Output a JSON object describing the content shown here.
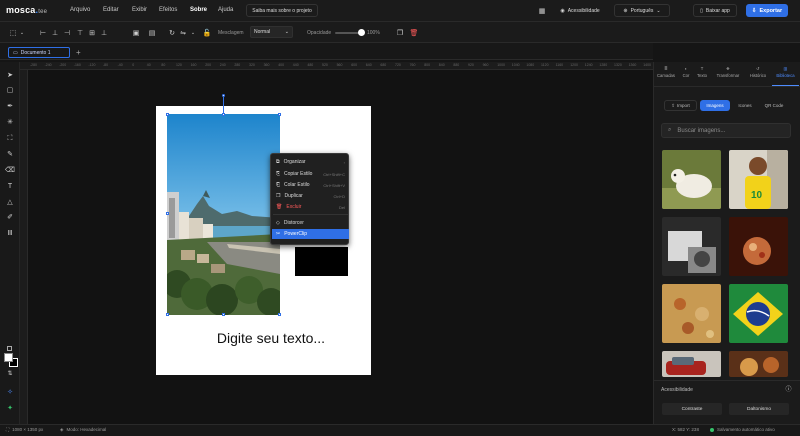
{
  "header": {
    "logo_main": "mosca",
    "logo_dot": ".",
    "logo_suffix": "tee",
    "menu": [
      "Arquivo",
      "Editar",
      "Exibir",
      "Efeitos",
      "Sobre",
      "Ajuda"
    ],
    "active_menu": "Sobre",
    "project_button": "Saiba mais sobre o projeto",
    "accessibility": "Acessibilidade",
    "language": "Português",
    "download_app": "Baixar app",
    "export": "Exportar"
  },
  "toolbar": {
    "blend_label": "Mesclagem",
    "blend_value": "Normal",
    "opacity_label": "Opacidade",
    "opacity_value": "100%"
  },
  "document_tab": {
    "label": "Documento 1",
    "add": "+"
  },
  "ruler": {
    "h_ticks": [
      "-280",
      "-240",
      "-200",
      "-160",
      "-120",
      "-80",
      "-40",
      "0",
      "40",
      "80",
      "120",
      "160",
      "200",
      "240",
      "280",
      "320",
      "360",
      "400",
      "440",
      "480",
      "520",
      "560",
      "600",
      "640",
      "680",
      "720",
      "760",
      "800",
      "840",
      "880",
      "920",
      "960",
      "1000",
      "1040",
      "1080",
      "1120",
      "1160",
      "1200",
      "1240",
      "1280",
      "1320",
      "1360",
      "1400"
    ]
  },
  "canvas": {
    "text": "Digite seu texto..."
  },
  "context_menu": {
    "items": [
      {
        "label": "Organizar",
        "shortcut": "›",
        "icon": "⧉",
        "style": "normal"
      },
      {
        "label": "Copiar Estilo",
        "shortcut": "Ctrl+Shift+C",
        "icon": "⎘",
        "style": "normal"
      },
      {
        "label": "Colar Estilo",
        "shortcut": "Ctrl+Shift+V",
        "icon": "⎗",
        "style": "normal"
      },
      {
        "label": "Duplicar",
        "shortcut": "Ctrl+D",
        "icon": "❐",
        "style": "normal"
      },
      {
        "label": "Excluir",
        "shortcut": "Del",
        "icon": "🗑",
        "style": "danger"
      },
      {
        "label": "Distorcer",
        "shortcut": "",
        "icon": "◇",
        "style": "normal"
      },
      {
        "label": "PowerClip",
        "shortcut": "",
        "icon": "✂",
        "style": "selected"
      }
    ]
  },
  "right_panel": {
    "tabs": [
      {
        "label": "Camadas",
        "icon": "≣"
      },
      {
        "label": "Cor",
        "icon": "◐"
      },
      {
        "label": "Texto",
        "icon": "T"
      },
      {
        "label": "Transformar",
        "icon": "✥"
      },
      {
        "label": "Histórico",
        "icon": "↺"
      },
      {
        "label": "Biblioteca",
        "icon": "▥"
      }
    ],
    "active_tab": "Biblioteca",
    "subtabs": [
      {
        "label": "Import",
        "icon": "⇪"
      },
      {
        "label": "Imagens",
        "icon": ""
      },
      {
        "label": "Icones",
        "icon": ""
      },
      {
        "label": "QR Code",
        "icon": ""
      }
    ],
    "active_subtab": "Imagens",
    "search_placeholder": "Buscar imagens...",
    "accessibility_title": "Acessibilidade",
    "contrast_button": "Contraste",
    "daltonism_button": "Daltonismo"
  },
  "status": {
    "canvas_size": "1080 × 1350 px",
    "mode": "Modo: Hexadecimal",
    "coords": "X: 582 Y: 238",
    "autosave": "Salvamento automático ativo"
  },
  "colors": {
    "accent": "#2f6fe6",
    "danger": "#ff5a5a",
    "autosave": "#36c26a"
  }
}
